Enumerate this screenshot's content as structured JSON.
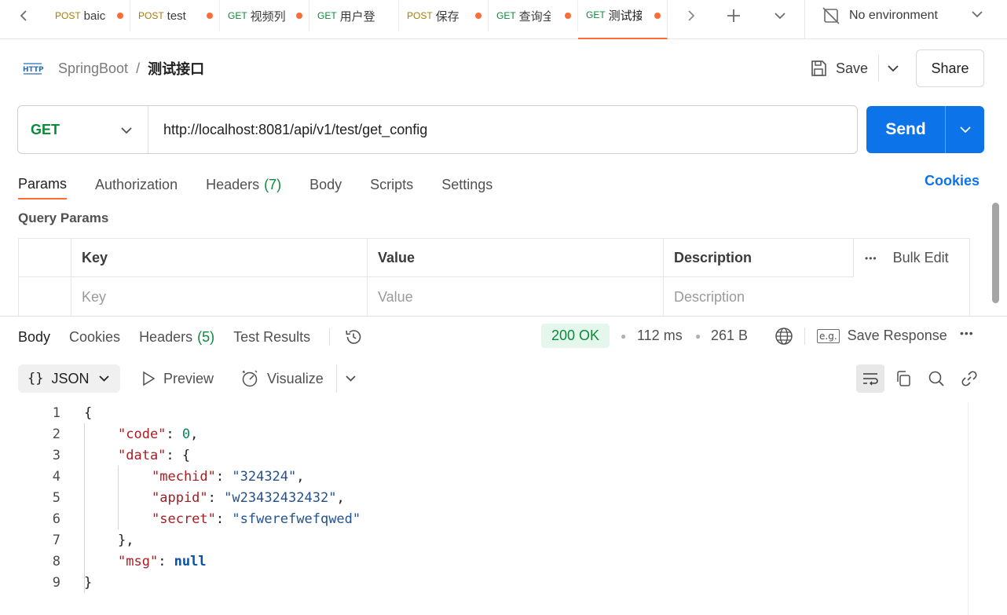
{
  "tabs": [
    {
      "method": "POST",
      "name": "baic",
      "active": false
    },
    {
      "method": "POST",
      "name": "test",
      "active": false
    },
    {
      "method": "GET",
      "name": "视频列",
      "active": false
    },
    {
      "method": "GET",
      "name": "用户登",
      "active": false
    },
    {
      "method": "POST",
      "name": "保存",
      "active": false
    },
    {
      "method": "GET",
      "name": "查询全",
      "active": false
    },
    {
      "method": "GET",
      "name": "测试接",
      "active": true
    }
  ],
  "environment": "No environment",
  "breadcrumb": {
    "collection": "SpringBoot",
    "separator": "/",
    "request": "测试接口"
  },
  "header": {
    "save_label": "Save",
    "share_label": "Share"
  },
  "request": {
    "method": "GET",
    "url": "http://localhost:8081/api/v1/test/get_config",
    "send_label": "Send"
  },
  "request_tabs": [
    {
      "label": "Params",
      "count": ""
    },
    {
      "label": "Authorization",
      "count": ""
    },
    {
      "label": "Headers",
      "count": "(7)"
    },
    {
      "label": "Body",
      "count": ""
    },
    {
      "label": "Scripts",
      "count": ""
    },
    {
      "label": "Settings",
      "count": ""
    }
  ],
  "cookies_link": "Cookies",
  "query_params": {
    "title": "Query Params",
    "columns": [
      "Key",
      "Value",
      "Description"
    ],
    "placeholders": [
      "Key",
      "Value",
      "Description"
    ],
    "bulk_edit": "Bulk Edit"
  },
  "response": {
    "tabs": [
      {
        "label": "Body",
        "count": ""
      },
      {
        "label": "Cookies",
        "count": ""
      },
      {
        "label": "Headers",
        "count": "(5)"
      },
      {
        "label": "Test Results",
        "count": ""
      }
    ],
    "status": "200 OK",
    "time": "112 ms",
    "size": "261 B",
    "save_response": "Save Response",
    "format": "JSON",
    "preview": "Preview",
    "visualize": "Visualize"
  },
  "body_lines": [
    {
      "num": "1",
      "indent": 0,
      "tokens": [
        {
          "t": "{",
          "c": "p"
        }
      ]
    },
    {
      "num": "2",
      "indent": 1,
      "tokens": [
        {
          "t": "\"code\"",
          "c": "k"
        },
        {
          "t": ": ",
          "c": "p"
        },
        {
          "t": "0",
          "c": "n"
        },
        {
          "t": ",",
          "c": "p"
        }
      ]
    },
    {
      "num": "3",
      "indent": 1,
      "tokens": [
        {
          "t": "\"data\"",
          "c": "k"
        },
        {
          "t": ": {",
          "c": "p"
        }
      ]
    },
    {
      "num": "4",
      "indent": 2,
      "tokens": [
        {
          "t": "\"mechid\"",
          "c": "k"
        },
        {
          "t": ": ",
          "c": "p"
        },
        {
          "t": "\"324324\"",
          "c": "s"
        },
        {
          "t": ",",
          "c": "p"
        }
      ]
    },
    {
      "num": "5",
      "indent": 2,
      "tokens": [
        {
          "t": "\"appid\"",
          "c": "k"
        },
        {
          "t": ": ",
          "c": "p"
        },
        {
          "t": "\"w23432432432\"",
          "c": "s"
        },
        {
          "t": ",",
          "c": "p"
        }
      ]
    },
    {
      "num": "6",
      "indent": 2,
      "tokens": [
        {
          "t": "\"secret\"",
          "c": "k"
        },
        {
          "t": ": ",
          "c": "p"
        },
        {
          "t": "\"sfwerefwefqwed\"",
          "c": "s"
        }
      ]
    },
    {
      "num": "7",
      "indent": 1,
      "tokens": [
        {
          "t": "},",
          "c": "p"
        }
      ]
    },
    {
      "num": "8",
      "indent": 1,
      "tokens": [
        {
          "t": "\"msg\"",
          "c": "k"
        },
        {
          "t": ": ",
          "c": "p"
        },
        {
          "t": "null",
          "c": "kw"
        }
      ]
    },
    {
      "num": "9",
      "indent": 0,
      "tokens": [
        {
          "t": "}",
          "c": "p"
        }
      ]
    }
  ],
  "colors": {
    "accent": "#ff6c37",
    "send": "#0d73e8",
    "get": "#0a8a3a",
    "post": "#ad7a03"
  },
  "icons": [
    "chevron-left-icon",
    "chevron-right-icon",
    "plus-icon",
    "chevron-down-icon",
    "no-environment-icon",
    "http-icon",
    "save-icon",
    "history-icon",
    "globe-icon",
    "save-response-icon",
    "more-icon",
    "play-icon",
    "visualize-icon",
    "wrap-icon",
    "copy-icon",
    "search-icon",
    "link-icon"
  ]
}
